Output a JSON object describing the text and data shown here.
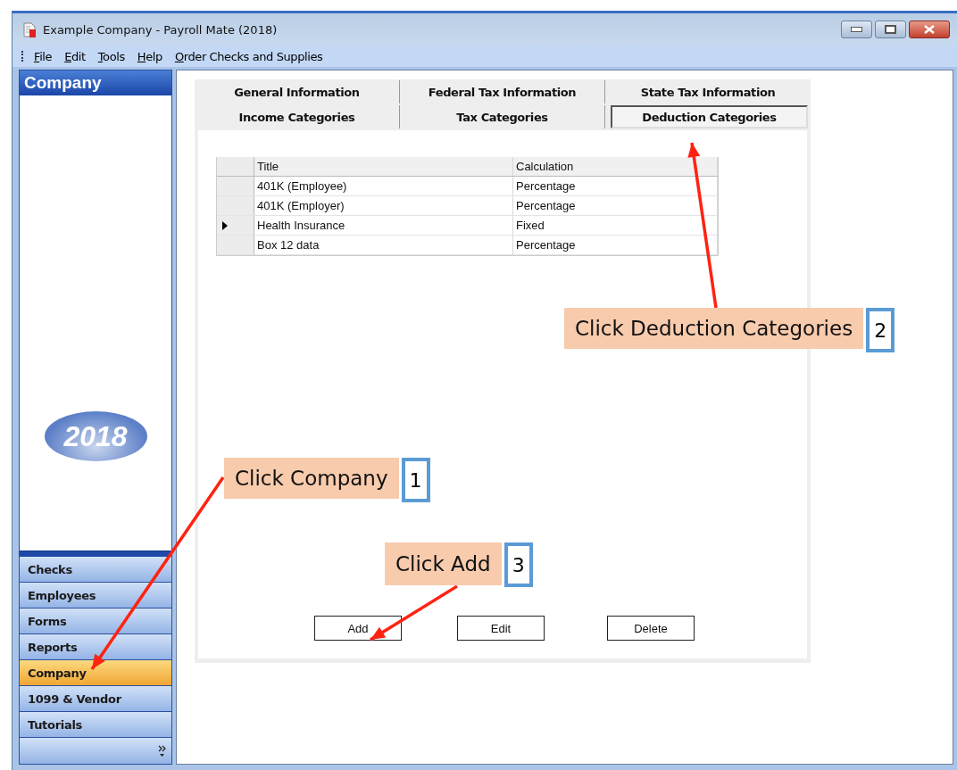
{
  "window": {
    "title": "Example Company - Payroll Mate (2018)"
  },
  "menu": [
    {
      "label": "File"
    },
    {
      "label": "Edit"
    },
    {
      "label": "Tools"
    },
    {
      "label": "Help"
    },
    {
      "label": "Order Checks and Supplies"
    }
  ],
  "sidebar": {
    "header": "Company",
    "logo_text": "2018",
    "items": [
      {
        "label": "Checks",
        "selected": false
      },
      {
        "label": "Employees",
        "selected": false
      },
      {
        "label": "Forms",
        "selected": false
      },
      {
        "label": "Reports",
        "selected": false
      },
      {
        "label": "Company",
        "selected": true
      },
      {
        "label": "1099 & Vendor",
        "selected": false
      },
      {
        "label": "Tutorials",
        "selected": false
      }
    ]
  },
  "tab_rows": [
    [
      {
        "label": "General Information",
        "selected": false
      },
      {
        "label": "Federal Tax Information",
        "selected": false
      },
      {
        "label": "State Tax Information",
        "selected": false
      }
    ],
    [
      {
        "label": "Income Categories",
        "selected": false
      },
      {
        "label": "Tax Categories",
        "selected": false
      },
      {
        "label": "Deduction Categories",
        "selected": true
      }
    ]
  ],
  "table": {
    "columns": [
      "Title",
      "Calculation"
    ],
    "rows": [
      {
        "title": "401K (Employee)",
        "calculation": "Percentage",
        "current": false
      },
      {
        "title": "401K (Employer)",
        "calculation": "Percentage",
        "current": false
      },
      {
        "title": "Health Insurance",
        "calculation": "Fixed",
        "current": true
      },
      {
        "title": "Box 12 data",
        "calculation": "Percentage",
        "current": false
      }
    ]
  },
  "buttons": [
    "Add",
    "Edit",
    "Delete"
  ],
  "callouts": [
    {
      "text": "Click Company",
      "number": "1"
    },
    {
      "text": "Click Deduction Categories",
      "number": "2"
    },
    {
      "text": "Click Add",
      "number": "3"
    }
  ]
}
